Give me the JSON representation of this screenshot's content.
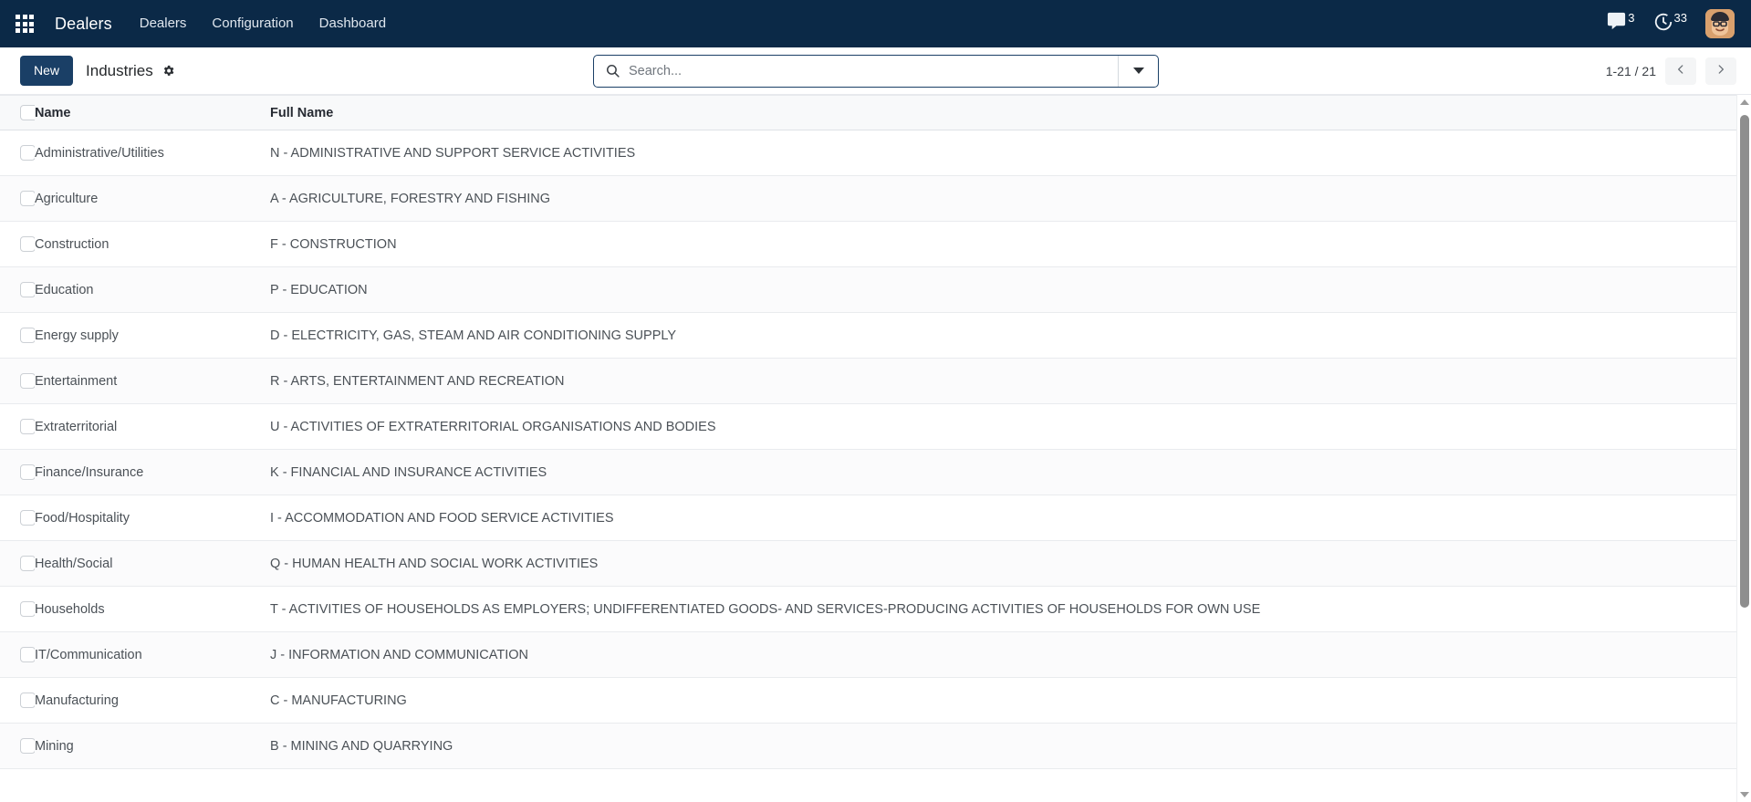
{
  "navbar": {
    "apps_icon": "apps-grid-icon",
    "brand": "Dealers",
    "menu": [
      {
        "label": "Dealers"
      },
      {
        "label": "Configuration"
      },
      {
        "label": "Dashboard"
      }
    ],
    "messages": {
      "icon": "chat-bubble-icon",
      "count": "3"
    },
    "activities": {
      "icon": "clock-activity-icon",
      "count": "33"
    },
    "avatar": {
      "icon": "user-avatar",
      "alt": "User avatar"
    },
    "background_color": "#0b2947"
  },
  "toolbar": {
    "new_label": "New",
    "breadcrumb_title": "Industries",
    "settings_icon": "gear-icon",
    "new_button_color": "#1a3f66"
  },
  "search": {
    "icon": "search-icon",
    "placeholder": "Search...",
    "value": "",
    "dropdown_icon": "chevron-down-icon"
  },
  "pager": {
    "range": "1-21 / 21",
    "prev_icon": "chevron-left-icon",
    "next_icon": "chevron-right-icon"
  },
  "table": {
    "columns": [
      "Name",
      "Full Name"
    ],
    "rows": [
      {
        "name": "Administrative/Utilities",
        "full_name": "N - ADMINISTRATIVE AND SUPPORT SERVICE ACTIVITIES"
      },
      {
        "name": "Agriculture",
        "full_name": "A - AGRICULTURE, FORESTRY AND FISHING"
      },
      {
        "name": "Construction",
        "full_name": "F - CONSTRUCTION"
      },
      {
        "name": "Education",
        "full_name": "P - EDUCATION"
      },
      {
        "name": "Energy supply",
        "full_name": "D - ELECTRICITY, GAS, STEAM AND AIR CONDITIONING SUPPLY"
      },
      {
        "name": "Entertainment",
        "full_name": "R - ARTS, ENTERTAINMENT AND RECREATION"
      },
      {
        "name": "Extraterritorial",
        "full_name": "U - ACTIVITIES OF EXTRATERRITORIAL ORGANISATIONS AND BODIES"
      },
      {
        "name": "Finance/Insurance",
        "full_name": "K - FINANCIAL AND INSURANCE ACTIVITIES"
      },
      {
        "name": "Food/Hospitality",
        "full_name": "I - ACCOMMODATION AND FOOD SERVICE ACTIVITIES"
      },
      {
        "name": "Health/Social",
        "full_name": "Q - HUMAN HEALTH AND SOCIAL WORK ACTIVITIES"
      },
      {
        "name": "Households",
        "full_name": "T - ACTIVITIES OF HOUSEHOLDS AS EMPLOYERS; UNDIFFERENTIATED GOODS- AND SERVICES-PRODUCING ACTIVITIES OF HOUSEHOLDS FOR OWN USE"
      },
      {
        "name": "IT/Communication",
        "full_name": "J - INFORMATION AND COMMUNICATION"
      },
      {
        "name": "Manufacturing",
        "full_name": "C - MANUFACTURING"
      },
      {
        "name": "Mining",
        "full_name": "B - MINING AND QUARRYING"
      }
    ]
  },
  "scrollbar": {
    "up_icon": "scroll-up-arrow-icon",
    "down_icon": "scroll-down-arrow-icon"
  }
}
